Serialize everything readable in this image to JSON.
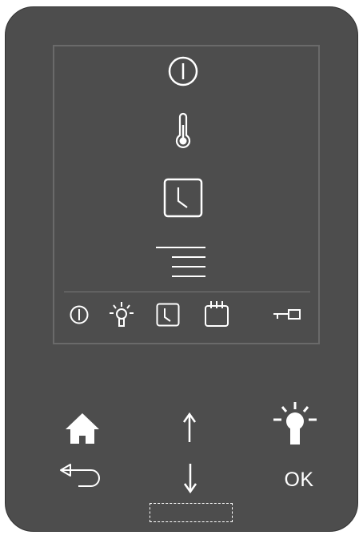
{
  "panel": {
    "menu_items": [
      {
        "name": "power-icon"
      },
      {
        "name": "thermometer-icon"
      },
      {
        "name": "clock-icon"
      },
      {
        "name": "menu-lines-icon"
      }
    ],
    "status_icons": [
      "power-icon",
      "light-bulb-icon",
      "clock-icon",
      "calendar-icon",
      "key-lock-icon"
    ]
  },
  "keys": {
    "home": {
      "icon": "home-icon"
    },
    "up": {
      "icon": "arrow-up-icon"
    },
    "light": {
      "icon": "light-bulb-icon"
    },
    "back": {
      "icon": "back-arrow-icon"
    },
    "down": {
      "icon": "arrow-down-icon"
    },
    "ok_label": "OK"
  },
  "colors": {
    "housing": "#4d4d4d",
    "icon": "#ffffff",
    "screen_border": "#6a6a6a"
  }
}
